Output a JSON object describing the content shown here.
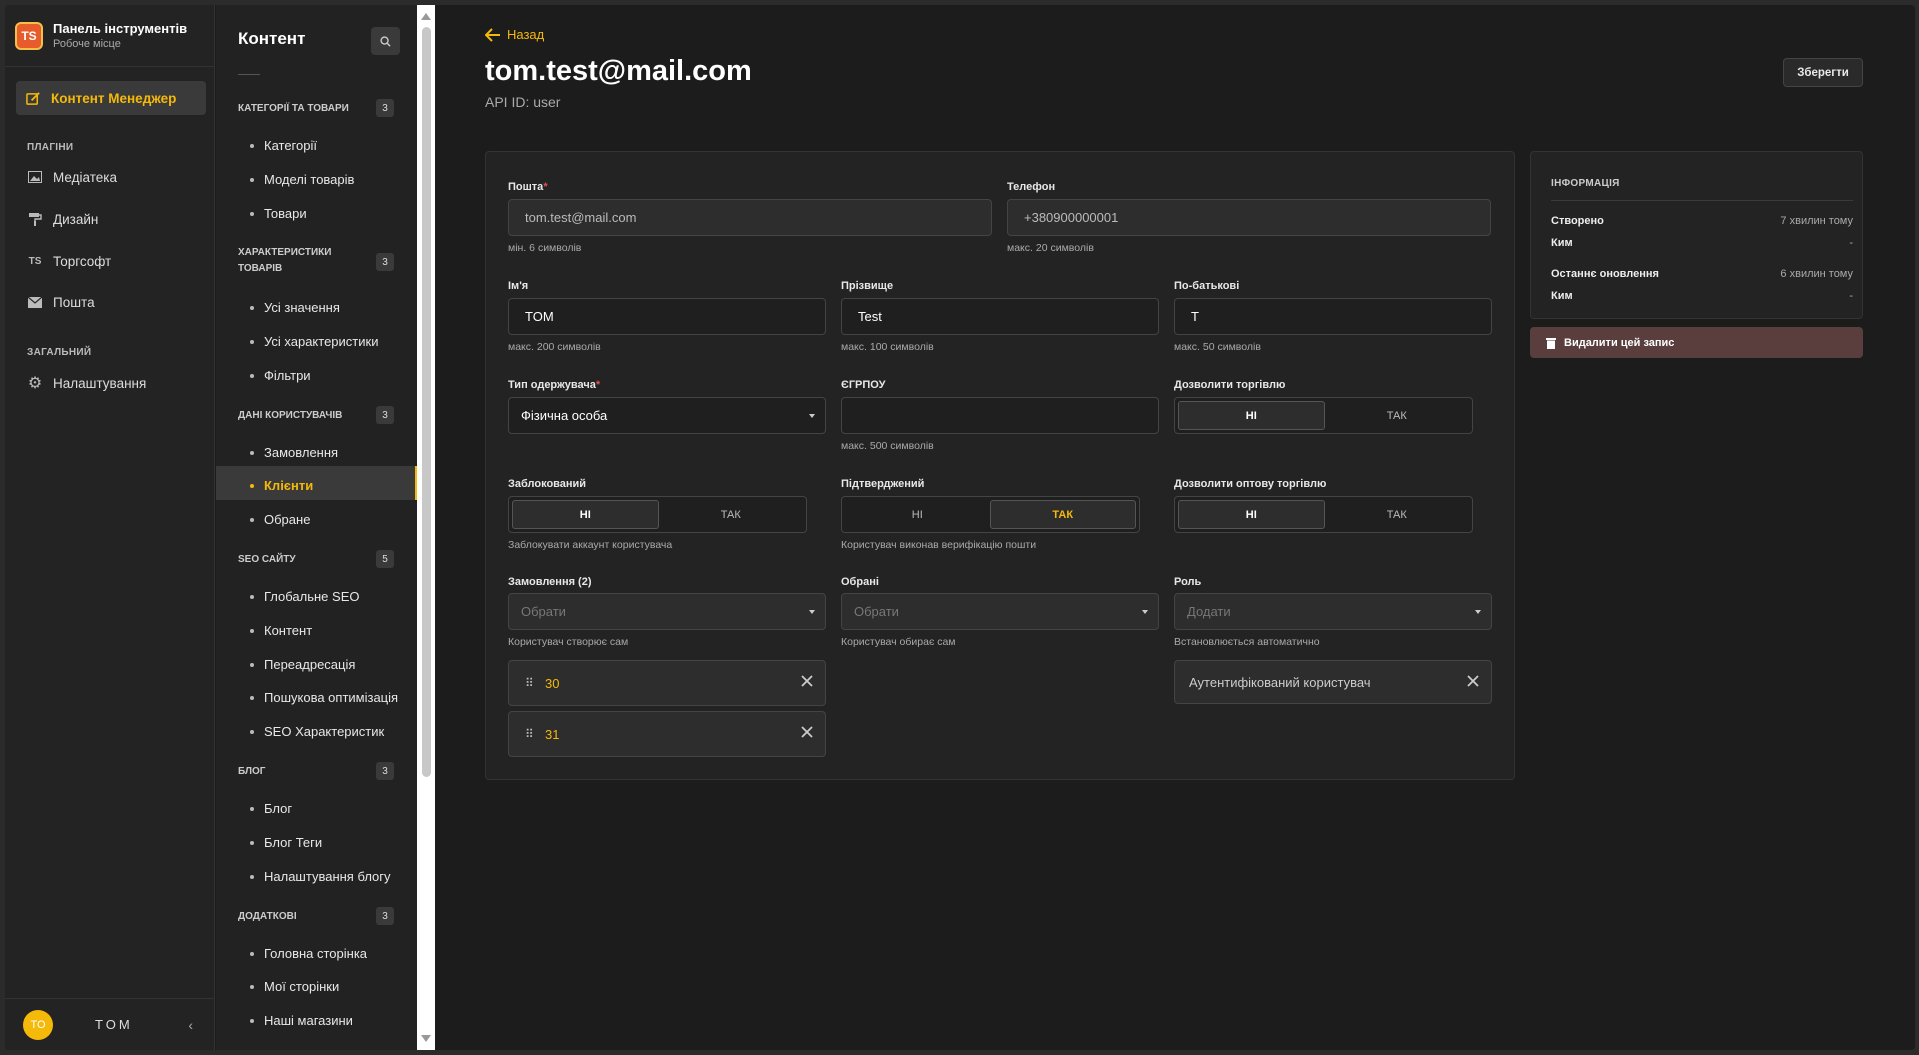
{
  "brand": {
    "title": "Панель інструментів",
    "subtitle": "Робоче місце",
    "logo_text": "TS"
  },
  "mainnav": {
    "active_label": "Контент Менеджер",
    "section_plugins": "ПЛАГІНИ",
    "plugins": [
      {
        "label": "Медіатека",
        "icon": "image-icon"
      },
      {
        "label": "Дизайн",
        "icon": "paint-roller-icon"
      },
      {
        "label": "Торгсофт",
        "icon": "ts-icon"
      },
      {
        "label": "Пошта",
        "icon": "mail-icon"
      }
    ],
    "section_general": "ЗАГАЛЬНИЙ",
    "settings_label": "Налаштування"
  },
  "user": {
    "initials": "TO",
    "name": "TOM"
  },
  "contentnav": {
    "title": "Контент",
    "groups": [
      {
        "title": "КАТЕГОРІЇ ТА ТОВАРИ",
        "count": "3",
        "items": [
          "Категорії",
          "Моделі товарів",
          "Товари"
        ]
      },
      {
        "title": "ХАРАКТЕРИСТИКИ ТОВАРІВ",
        "count": "3",
        "items": [
          "Усі значення",
          "Усі характеристики",
          "Фільтри"
        ]
      },
      {
        "title": "ДАНІ КОРИСТУВАЧІВ",
        "count": "3",
        "items": [
          "Замовлення",
          "Клієнти",
          "Обране"
        ]
      },
      {
        "title": "SEO САЙТУ",
        "count": "5",
        "items": [
          "Глобальне SEO",
          "Контент",
          "Переадресація",
          "Пошукова оптимізація",
          "SEO Характеристик"
        ]
      },
      {
        "title": "БЛОГ",
        "count": "3",
        "items": [
          "Блог",
          "Блог Теги",
          "Налаштування блогу"
        ]
      },
      {
        "title": "ДОДАТКОВІ",
        "count": "3",
        "items": [
          "Головна сторінка",
          "Мої сторінки",
          "Наші магазини"
        ]
      }
    ]
  },
  "header": {
    "back": "Назад",
    "title": "tom.test@mail.com",
    "api_id": "API ID: user",
    "save": "Зберегти"
  },
  "form": {
    "email": {
      "label": "Пошта",
      "value": "tom.test@mail.com",
      "hint": "мін. 6 символів"
    },
    "phone": {
      "label": "Телефон",
      "value": "+380900000001",
      "hint": "макс. 20 символів"
    },
    "first_name": {
      "label": "Ім'я",
      "value": "TOM",
      "hint": "макс. 200 символів"
    },
    "last_name": {
      "label": "Прізвище",
      "value": "Test",
      "hint": "макс. 100 символів"
    },
    "patronymic": {
      "label": "По-батькові",
      "value": "T",
      "hint": "макс. 50 символів"
    },
    "recipient_type": {
      "label": "Тип одержувача",
      "value": "Фізична особа"
    },
    "edrpou": {
      "label": "ЄГРПОУ",
      "value": "",
      "hint": "макс. 500 символів"
    },
    "allow_trade": {
      "label": "Дозволити торгівлю",
      "no": "НІ",
      "yes": "ТАК"
    },
    "blocked": {
      "label": "Заблокований",
      "no": "НІ",
      "yes": "ТАК",
      "hint": "Заблокувати аккаунт користувача"
    },
    "confirmed": {
      "label": "Підтверджений",
      "no": "НІ",
      "yes": "ТАК",
      "hint": "Користувач виконав верифікацію пошти"
    },
    "allow_wholesale": {
      "label": "Дозволити оптову торгівлю",
      "no": "НІ",
      "yes": "ТАК"
    },
    "orders": {
      "label": "Замовлення (2)",
      "placeholder": "Обрати",
      "hint": "Користувач створює сам",
      "items": [
        "30",
        "31"
      ]
    },
    "favorites": {
      "label": "Обрані",
      "placeholder": "Обрати",
      "hint": "Користувач обирає сам"
    },
    "role": {
      "label": "Роль",
      "placeholder": "Додати",
      "hint": "Встановлюється автоматично",
      "value": "Аутентифікований користувач"
    }
  },
  "info": {
    "title": "ІНФОРМАЦІЯ",
    "created_label": "Створено",
    "created_value": "7 хвилин тому",
    "by_label": "Ким",
    "by_value": "-",
    "updated_label": "Останнє оновлення",
    "updated_value": "6 хвилин тому",
    "by2_label": "Ким",
    "by2_value": "-"
  },
  "delete_label": "Видалити цей запис",
  "colors": {
    "accent": "#f5b90a",
    "danger_bg": "#5a3e3e"
  }
}
